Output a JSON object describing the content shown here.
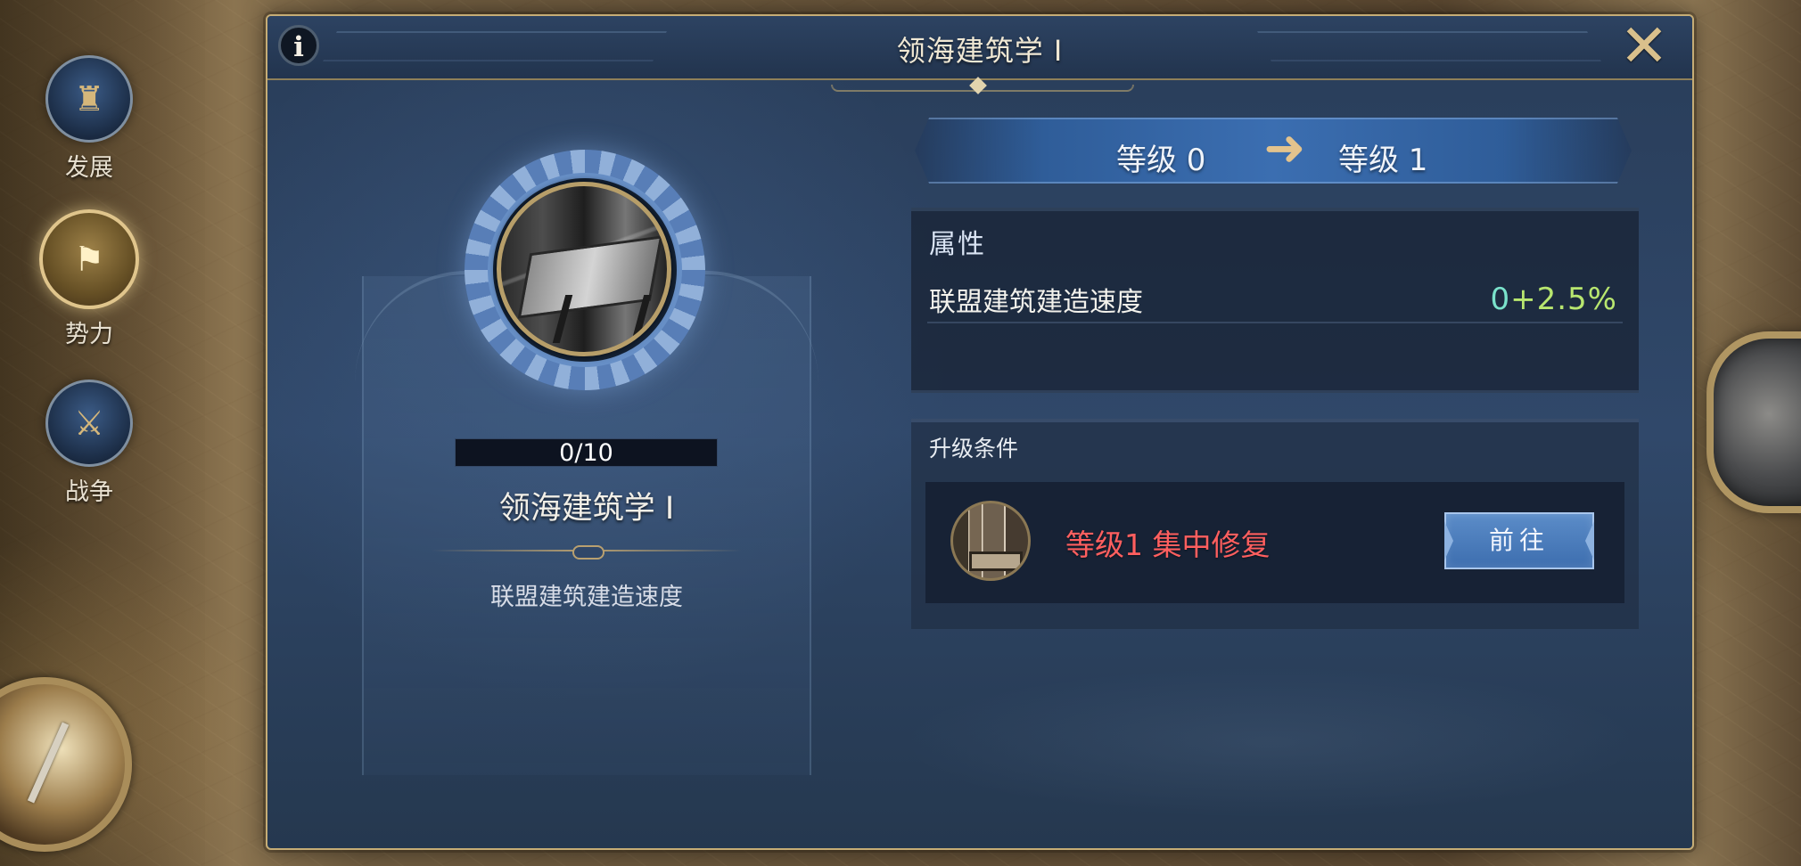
{
  "sidebar": {
    "items": [
      {
        "label": "发展",
        "icon": "castle-icon",
        "active": false
      },
      {
        "label": "势力",
        "icon": "flag-icon",
        "active": true
      },
      {
        "label": "战争",
        "icon": "crossed-swords-icon",
        "active": false
      }
    ]
  },
  "dialog": {
    "title": "领海建筑学 Ⅰ",
    "info_label": "i",
    "close_label": "✕"
  },
  "tech": {
    "progress_text": "0/10",
    "progress_fraction": 0,
    "name": "领海建筑学 Ⅰ",
    "description": "联盟建筑建造速度"
  },
  "level": {
    "current": "等级 0",
    "next": "等级 1",
    "arrow": "➜"
  },
  "attributes": {
    "title": "属性",
    "items": [
      {
        "name": "联盟建筑建造速度",
        "base_value": "0",
        "increment": "+2.5%"
      }
    ]
  },
  "requirements": {
    "title": "升级条件",
    "items": [
      {
        "text": "等级1 集中修复",
        "button_label": "前往",
        "status_color": "#ff5f5f"
      }
    ]
  }
}
